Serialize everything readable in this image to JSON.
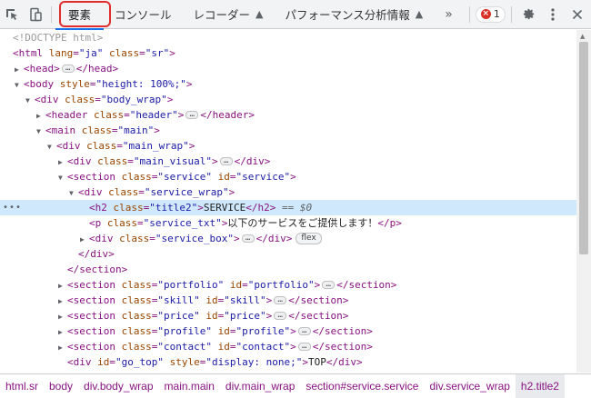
{
  "toolbar": {
    "tabs": [
      {
        "label": "要素"
      },
      {
        "label": "コンソール"
      },
      {
        "label": "レコーダー"
      },
      {
        "label": "パフォーマンス分析情報"
      }
    ],
    "more": "»",
    "error_count": "1",
    "error_mark": "×",
    "colors": {
      "accent": "#1a73e8",
      "highlight": "#e02d2d"
    }
  },
  "tree": {
    "doctype": "<!DOCTYPE html>",
    "selected_marker": "== $0"
  },
  "breadcrumbs": [
    "html.sr",
    "body",
    "div.body_wrap",
    "main.main",
    "div.main_wrap",
    "section#service.service",
    "div.service_wrap",
    "h2.title2"
  ]
}
